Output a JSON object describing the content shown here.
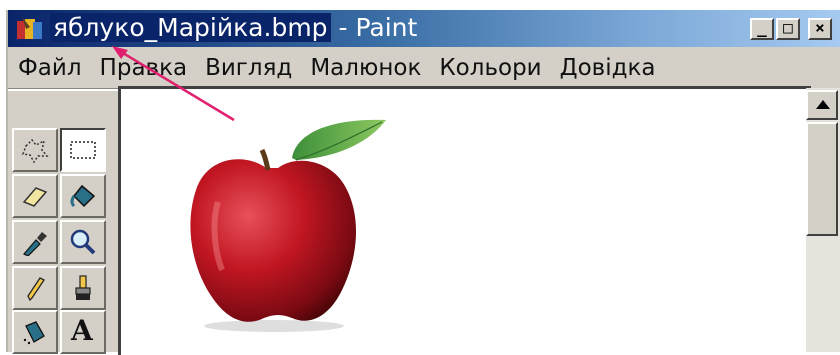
{
  "window": {
    "title_selected": "яблуко_Марійка.bmp",
    "title_rest": " - Paint",
    "controls": {
      "minimize": "_",
      "maximize": "□",
      "close": "×"
    }
  },
  "menu": {
    "items": [
      "Файл",
      "Правка",
      "Вигляд",
      "Малюнок",
      "Кольори",
      "Довідка"
    ]
  },
  "toolbox": {
    "tools": [
      {
        "name": "free-form-select-icon",
        "active": false
      },
      {
        "name": "select-icon",
        "active": true
      },
      {
        "name": "eraser-icon",
        "active": false
      },
      {
        "name": "fill-bucket-icon",
        "active": false
      },
      {
        "name": "color-picker-icon",
        "active": false
      },
      {
        "name": "magnifier-icon",
        "active": false
      },
      {
        "name": "pencil-icon",
        "active": false
      },
      {
        "name": "brush-icon",
        "active": false
      },
      {
        "name": "airbrush-icon",
        "active": false
      },
      {
        "name": "text-icon",
        "active": false
      }
    ],
    "text_tool_glyph": "A"
  },
  "canvas": {
    "image_subject": "red-apple-image"
  },
  "annotation": {
    "arrow_color": "#e0206e"
  }
}
